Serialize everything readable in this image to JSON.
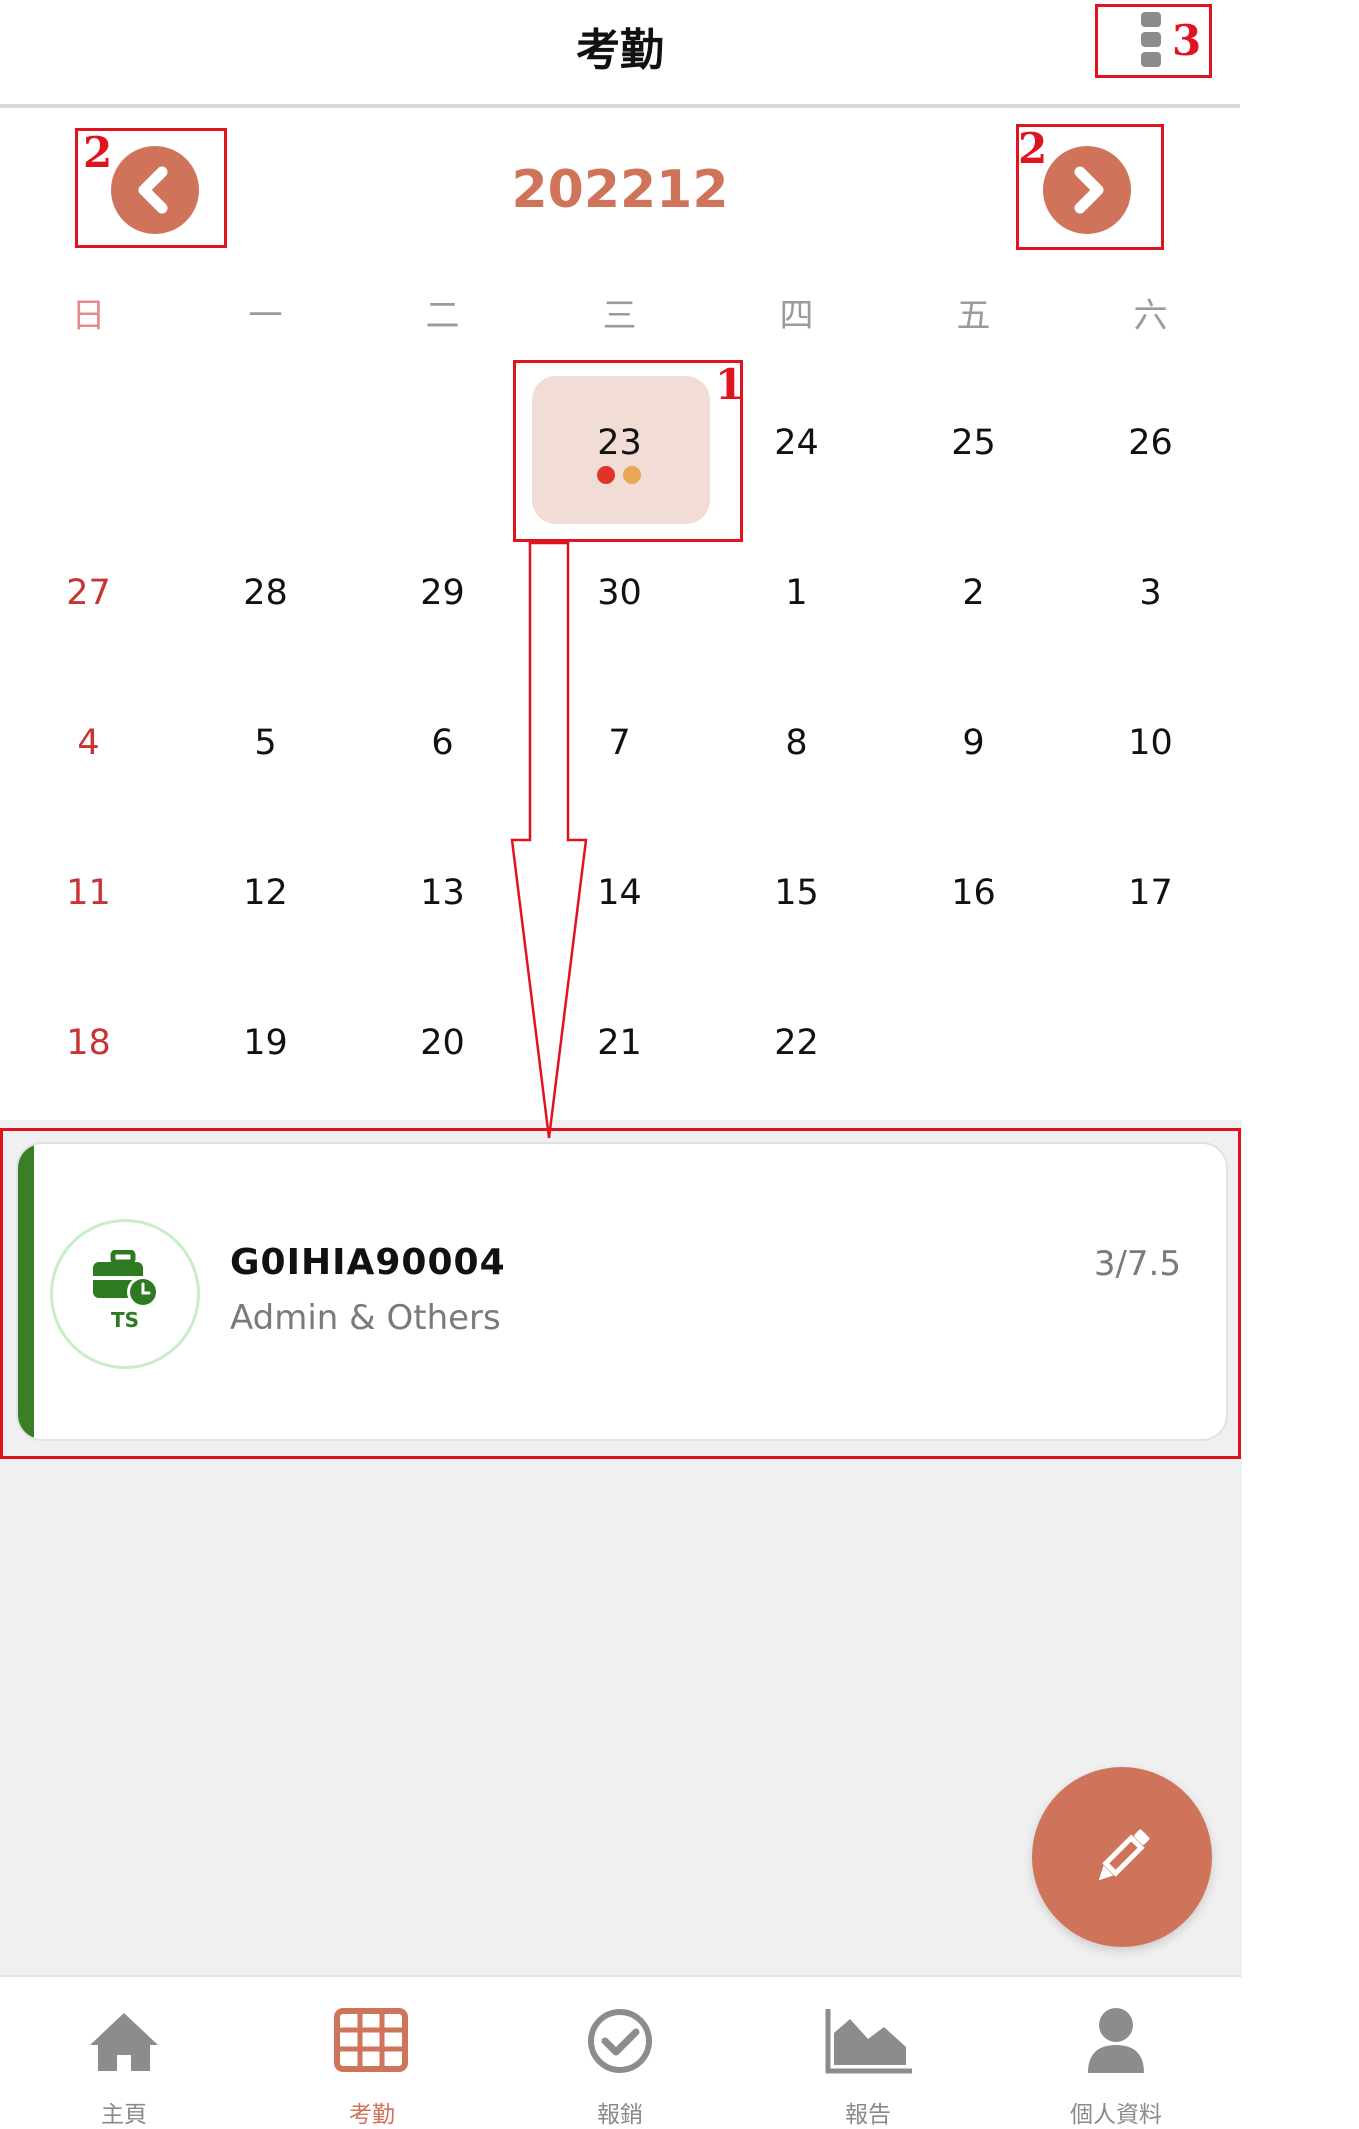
{
  "header": {
    "title": "考勤"
  },
  "calendar": {
    "month_label": "202212",
    "weekdays": [
      "日",
      "一",
      "二",
      "三",
      "四",
      "五",
      "六"
    ],
    "rows": [
      [
        "",
        "",
        "",
        "23",
        "24",
        "25",
        "26"
      ],
      [
        "27",
        "28",
        "29",
        "30",
        "1",
        "2",
        "3"
      ],
      [
        "4",
        "5",
        "6",
        "7",
        "8",
        "9",
        "10"
      ],
      [
        "11",
        "12",
        "13",
        "14",
        "15",
        "16",
        "17"
      ],
      [
        "18",
        "19",
        "20",
        "21",
        "22",
        "",
        ""
      ]
    ],
    "selected_day": "23",
    "selected_dot_colors": [
      "#e0342a",
      "#e8a857"
    ]
  },
  "timesheet_card": {
    "badge": "TS",
    "code": "G0IHIA90004",
    "category": "Admin & Others",
    "hours": "3/7.5",
    "accent_color": "#3a7f26"
  },
  "tabs": [
    {
      "label": "主頁",
      "icon": "home-icon"
    },
    {
      "label": "考勤",
      "icon": "calendar-grid-icon",
      "active": true
    },
    {
      "label": "報銷",
      "icon": "check-circle-icon"
    },
    {
      "label": "報告",
      "icon": "area-chart-icon"
    },
    {
      "label": "個人資料",
      "icon": "user-icon"
    }
  ],
  "annotations": {
    "a1": "1",
    "a2": "2",
    "a3": "3"
  },
  "colors": {
    "accent": "#cf735a",
    "annotation": "#e0141e"
  }
}
